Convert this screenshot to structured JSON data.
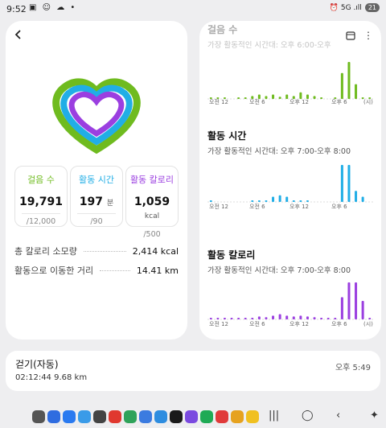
{
  "status": {
    "time": "9:52",
    "left_icons": "▣ ☺ ☁ •",
    "right_icons": "⏰ 5G .ıll",
    "battery": "21"
  },
  "summary": {
    "steps": {
      "label": "걸음 수",
      "value": "19,791",
      "goal": "/12,000",
      "color": "#6fbb1f"
    },
    "active_time": {
      "label": "활동 시간",
      "value": "197",
      "unit": "분",
      "goal": "/90",
      "color": "#21aee6"
    },
    "calories": {
      "label": "활동 칼로리",
      "value": "1,059",
      "unit": "kcal",
      "goal": "/500",
      "color": "#9b3fe0"
    }
  },
  "totals": [
    {
      "label": "총 칼로리 소모량",
      "value": "2,414 kcal"
    },
    {
      "label": "활동으로 이동한 거리",
      "value": "14.41 km"
    }
  ],
  "right": {
    "sections": [
      {
        "title": "걸음 수",
        "subtitle": "가장 활동적인 시간대: 오후 6:00-오후",
        "color": "#6fbb1f"
      },
      {
        "title": "활동 시간",
        "subtitle": "가장 활동적인 시간대: 오후 7:00-오후 8:00",
        "color": "#21aee6"
      },
      {
        "title": "활동 칼로리",
        "subtitle": "가장 활동적인 시간대: 오후 7:00-오후 8:00",
        "color": "#9b3fe0"
      }
    ],
    "axis_ticks": [
      "오전 12",
      "오전 6",
      "오후 12",
      "오후 6",
      "(시)"
    ],
    "axis_ticks_short": [
      "오전 12",
      "오전 6",
      "오후 12",
      "오후 6"
    ]
  },
  "chart_data": [
    {
      "type": "bar",
      "title": "걸음 수",
      "categories": [
        "0",
        "1",
        "2",
        "3",
        "4",
        "5",
        "6",
        "7",
        "8",
        "9",
        "10",
        "11",
        "12",
        "13",
        "14",
        "15",
        "16",
        "17",
        "18",
        "19",
        "20",
        "21",
        "22",
        "23"
      ],
      "values": [
        4,
        4,
        4,
        0,
        4,
        4,
        8,
        12,
        8,
        12,
        6,
        12,
        8,
        18,
        12,
        8,
        4,
        0,
        4,
        70,
        100,
        40,
        4,
        4
      ],
      "ylim": [
        0,
        100
      ]
    },
    {
      "type": "bar",
      "title": "활동 시간",
      "categories": [
        "0",
        "1",
        "2",
        "3",
        "4",
        "5",
        "6",
        "7",
        "8",
        "9",
        "10",
        "11",
        "12",
        "13",
        "14",
        "15",
        "16",
        "17",
        "18",
        "19",
        "20",
        "21",
        "22",
        "23"
      ],
      "values": [
        4,
        0,
        0,
        0,
        0,
        0,
        4,
        4,
        4,
        14,
        18,
        14,
        4,
        4,
        4,
        0,
        0,
        0,
        0,
        100,
        100,
        30,
        14,
        0
      ],
      "ylim": [
        0,
        100
      ]
    },
    {
      "type": "bar",
      "title": "활동 칼로리",
      "categories": [
        "0",
        "1",
        "2",
        "3",
        "4",
        "5",
        "6",
        "7",
        "8",
        "9",
        "10",
        "11",
        "12",
        "13",
        "14",
        "15",
        "16",
        "17",
        "18",
        "19",
        "20",
        "21",
        "22",
        "23"
      ],
      "values": [
        4,
        4,
        4,
        4,
        4,
        4,
        4,
        8,
        6,
        10,
        14,
        10,
        8,
        10,
        8,
        6,
        4,
        4,
        4,
        60,
        100,
        100,
        50,
        4
      ],
      "ylim": [
        0,
        100
      ]
    }
  ],
  "walk": {
    "title": "걷기(자동)",
    "details": "02:12:44   9.68 km",
    "time": "오후 5:49"
  },
  "dock": {
    "apps": [
      "grid-icon",
      "phone-icon",
      "messages-icon",
      "chat-icon",
      "camera-icon",
      "store-icon",
      "calendar-icon",
      "play-icon",
      "gallery-icon",
      "tv-icon",
      "notes-icon",
      "shopping-icon",
      "game-icon",
      "app-icon",
      "settings-icon"
    ]
  }
}
